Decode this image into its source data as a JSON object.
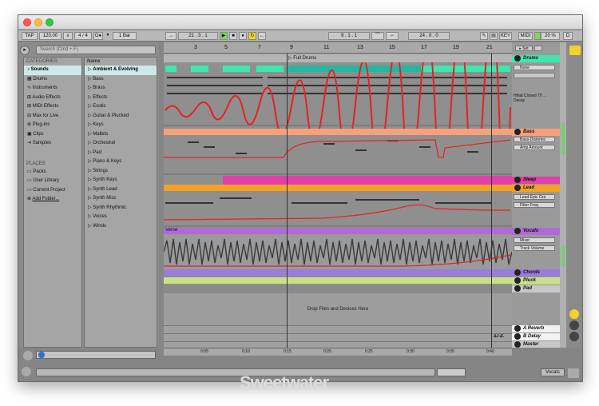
{
  "control_bar": {
    "tap": "TAP",
    "tempo": "120.00",
    "signature": "4 / 4",
    "quantize": "1 Bar",
    "arrangement_pos": [
      "21",
      "3",
      "1"
    ],
    "loop_start": [
      "9",
      "1",
      "1"
    ],
    "loop_length": [
      "24",
      "0",
      "0"
    ],
    "key": "KEY",
    "midi": "MIDI",
    "cpu": "20 %",
    "d": "D"
  },
  "browser": {
    "search_placeholder": "Search (Cmd + F)",
    "categories_heading": "CATEGORIES",
    "categories": [
      "Sounds",
      "Drums",
      "Instruments",
      "Audio Effects",
      "MIDI Effects",
      "Max for Live",
      "Plug-ins",
      "Clips",
      "Samples"
    ],
    "places_heading": "PLACES",
    "places": [
      "Packs",
      "User Library",
      "Current Project",
      "Add Folder..."
    ],
    "name_heading": "Name",
    "names": [
      "Ambient & Evolving",
      "Bass",
      "Brass",
      "Effects",
      "Exotic",
      "Guitar & Plucked",
      "Keys",
      "Mallets",
      "Orchestral",
      "Pad",
      "Piano & Keys",
      "Strings",
      "Synth Keys",
      "Synth Lead",
      "Synth Misc",
      "Synth Rhythmic",
      "Voices",
      "Winds"
    ]
  },
  "arrangement": {
    "bar_numbers": [
      "3",
      "5",
      "7",
      "9",
      "11",
      "13",
      "15",
      "17",
      "19",
      "21"
    ],
    "locator": "Full Drums",
    "set_label": "Set",
    "verse_label": "Verse",
    "drop_text": "Drop Files and Devices Here",
    "page_indicator": "1/2",
    "time_labels": [
      "0:05",
      "0:10",
      "0:15",
      "0:20",
      "0:25",
      "0:30",
      "0:35",
      "0:40"
    ]
  },
  "tracks": {
    "drums": {
      "name": "Drums",
      "device": "None",
      "param": "Hihat Closed 70 ...",
      "param2": "Decay"
    },
    "bass": {
      "name": "Bass",
      "device": "Bass-Distortec",
      "param": "Amp Amount"
    },
    "sleep": {
      "name": "Sleep"
    },
    "lead": {
      "name": "Lead",
      "device": "Lead-Epic Gra",
      "param": "Filter Freq"
    },
    "vocals": {
      "name": "Vocals",
      "device": "Mixer",
      "param": "Track Volume"
    },
    "chords": {
      "name": "Chords"
    },
    "pluck": {
      "name": "Pluck"
    },
    "pad": {
      "name": "Pad"
    },
    "reverb": {
      "name": "A Reverb"
    },
    "delay": {
      "name": "B Delay"
    },
    "master": {
      "name": "Master"
    }
  },
  "status": {
    "track_name": "Vocals"
  },
  "watermark": "Sweetwater",
  "colors": {
    "drums": "#3fe6b0",
    "bass": "#f7a07a",
    "sleep": "#e040a8",
    "lead": "#f3a223",
    "vocals": "#b06ad8",
    "chords": "#9a7be0",
    "pluck": "#c8e08a",
    "automation": "#e82020"
  }
}
